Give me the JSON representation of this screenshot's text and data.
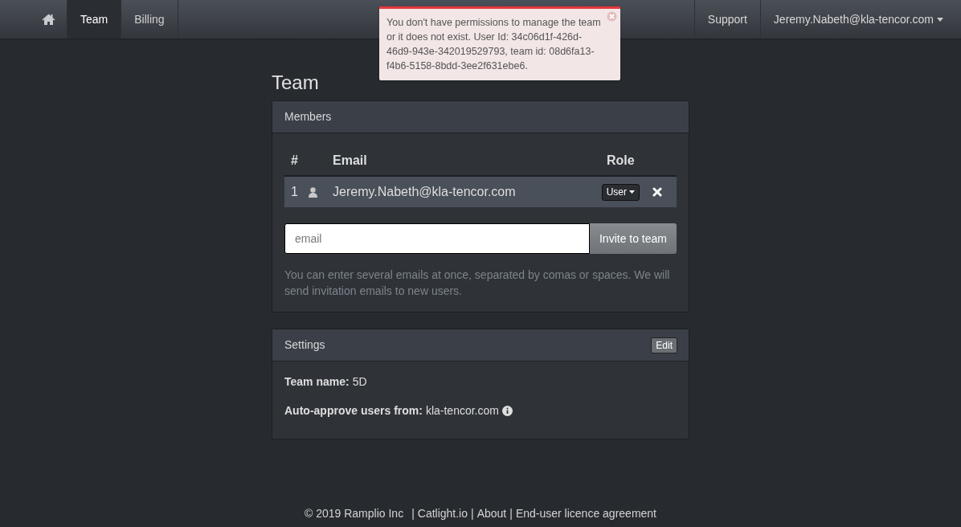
{
  "navbar": {
    "left": [
      {
        "kind": "home",
        "selected": false
      },
      {
        "kind": "link",
        "label": "Team",
        "selected": true
      },
      {
        "kind": "link",
        "label": "Billing",
        "selected": false
      }
    ],
    "support": "Support",
    "user_menu": "Jeremy.Nabeth@kla-tencor.com"
  },
  "alert": {
    "message": "You don't have permissions to manage the team or it does not exist. User Id: 34c06d1f-426d-46d9-943e-342019529793, team id: 08d6fa13-f4b6-5158-8bdd-3ee2f631ebe6."
  },
  "page_title": "Team",
  "members": {
    "title": "Members",
    "columns": [
      "#",
      "Email",
      "Role"
    ],
    "rows": [
      {
        "number": "1",
        "email": "Jeremy.Nabeth@kla-tencor.com",
        "role": "User"
      }
    ],
    "invite": {
      "placeholder": "email",
      "button": "Invite to team"
    },
    "help": "You can enter several emails at once, separated by comas or spaces. We will send invitation emails to new users."
  },
  "settings": {
    "title": "Settings",
    "edit_button": "Edit",
    "fields": [
      {
        "label": "Team name:",
        "value": "5D",
        "info": false
      },
      {
        "label": "Auto-approve users from:",
        "value": "kla-tencor.com",
        "info": true
      }
    ]
  },
  "footer": [
    {
      "kind": "text",
      "text": "© 2019 Ramplio Inc"
    },
    {
      "kind": "separator",
      "text": "|"
    },
    {
      "kind": "link",
      "text": "Catlight.io"
    },
    {
      "kind": "separator",
      "text": "|"
    },
    {
      "kind": "link",
      "text": "About"
    },
    {
      "kind": "separator",
      "text": "|"
    },
    {
      "kind": "link",
      "text": "End-user licence agreement"
    }
  ]
}
